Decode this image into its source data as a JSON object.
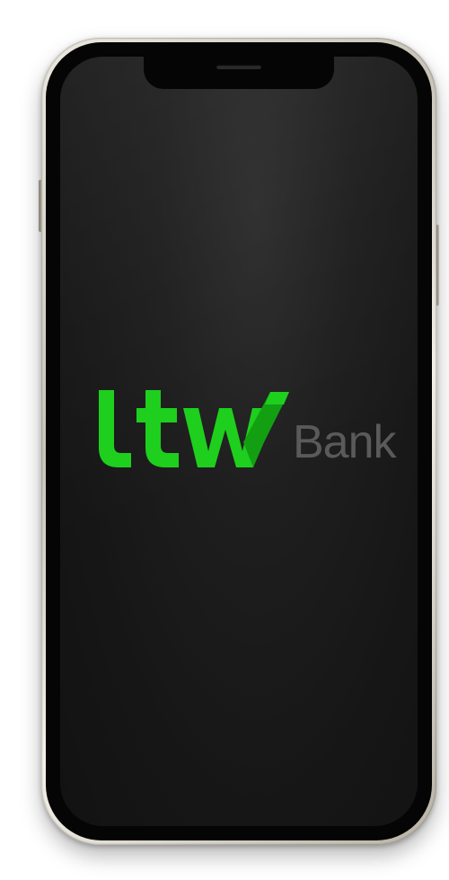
{
  "app": {
    "name": "LTW Bank",
    "logo": {
      "mark_text": "ltw",
      "word": "Bank",
      "mark_color": "#1ecf1e",
      "mark_shadow_color": "#12a012",
      "word_color": "#5a5a5a"
    }
  },
  "device": {
    "frame_color": "#d8d3c8",
    "screen_color": "#1c1c1c"
  }
}
